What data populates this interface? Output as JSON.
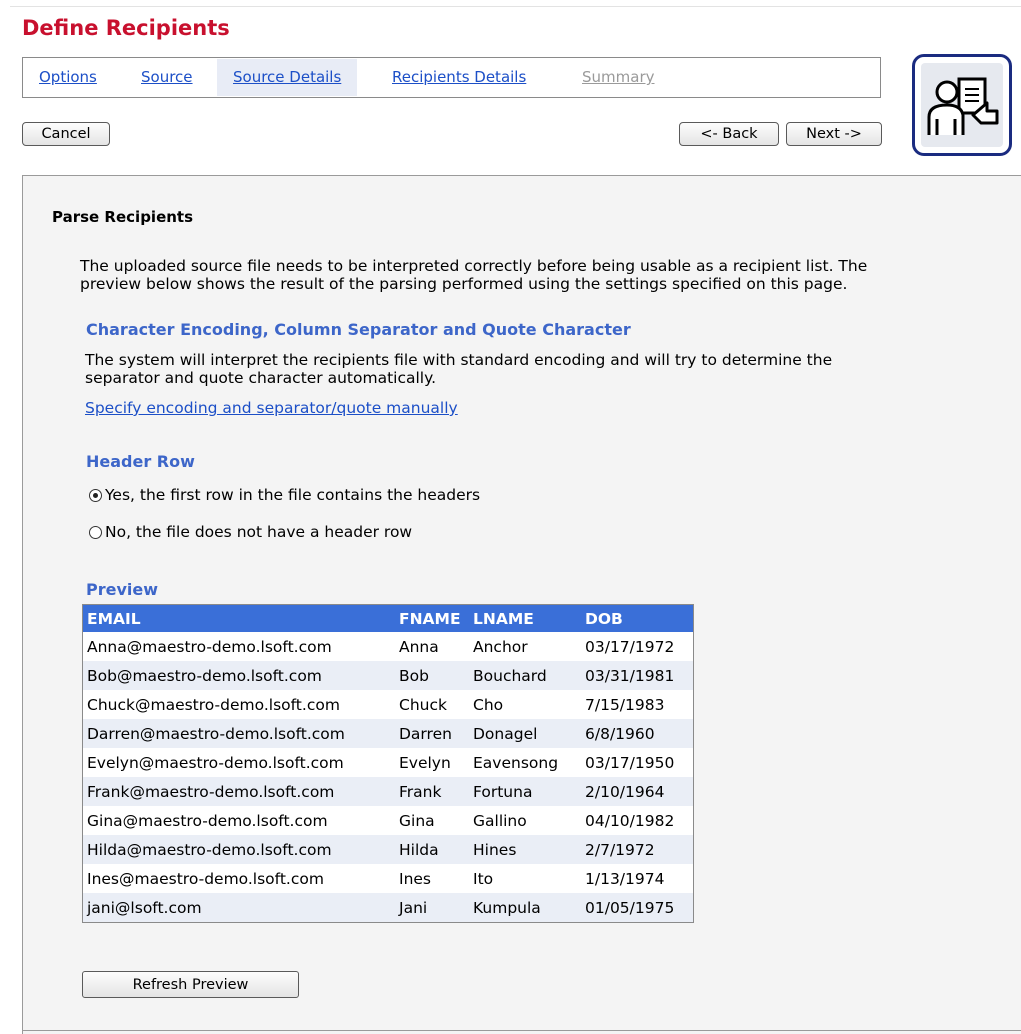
{
  "page": {
    "title": "Define Recipients"
  },
  "tabs": [
    {
      "label": "Options",
      "state": "link"
    },
    {
      "label": "Source",
      "state": "link"
    },
    {
      "label": "Source Details",
      "state": "active"
    },
    {
      "label": "Recipients Details",
      "state": "link"
    },
    {
      "label": "Summary",
      "state": "disabled"
    }
  ],
  "toolbar": {
    "cancel_label": "Cancel",
    "back_label": "<- Back",
    "next_label": "Next ->"
  },
  "logo": {
    "icon": "presenter-board-icon",
    "border_color": "#1a2b80"
  },
  "section": {
    "title": "Parse Recipients",
    "intro_line1": "The uploaded source file needs to be interpreted correctly before being usable as a recipient list. The",
    "intro_line2": "preview below shows the result of the parsing performed using the settings specified on this page.",
    "encoding": {
      "heading": "Character Encoding, Column Separator and Quote Character",
      "text_line1": "The system will interpret the recipients file with standard encoding and will try to determine the",
      "text_line2": "separator and quote character automatically.",
      "manual_link": "Specify encoding and separator/quote manually"
    },
    "header_row": {
      "heading": "Header Row",
      "options": [
        {
          "label": "Yes, the first row in the file contains the headers",
          "checked": true
        },
        {
          "label": "No, the file does not have a header row",
          "checked": false
        }
      ]
    },
    "preview": {
      "heading": "Preview",
      "columns": [
        "EMAIL",
        "FNAME",
        "LNAME",
        "DOB"
      ],
      "rows": [
        [
          "Anna@maestro-demo.lsoft.com",
          "Anna",
          "Anchor",
          "03/17/1972"
        ],
        [
          "Bob@maestro-demo.lsoft.com",
          "Bob",
          "Bouchard",
          "03/31/1981"
        ],
        [
          "Chuck@maestro-demo.lsoft.com",
          "Chuck",
          "Cho",
          "7/15/1983"
        ],
        [
          "Darren@maestro-demo.lsoft.com",
          "Darren",
          "Donagel",
          "6/8/1960"
        ],
        [
          "Evelyn@maestro-demo.lsoft.com",
          "Evelyn",
          "Eavensong",
          "03/17/1950"
        ],
        [
          "Frank@maestro-demo.lsoft.com",
          "Frank",
          "Fortuna",
          "2/10/1964"
        ],
        [
          "Gina@maestro-demo.lsoft.com",
          "Gina",
          "Gallino",
          "04/10/1982"
        ],
        [
          "Hilda@maestro-demo.lsoft.com",
          "Hilda",
          "Hines",
          "2/7/1972"
        ],
        [
          "Ines@maestro-demo.lsoft.com",
          "Ines",
          "Ito",
          "1/13/1974"
        ],
        [
          "jani@lsoft.com",
          "Jani",
          "Kumpula",
          "01/05/1975"
        ]
      ],
      "header_color": "#3a6fd8",
      "refresh_label": "Refresh Preview"
    }
  },
  "colors": {
    "title": "#c8102e",
    "link": "#1c4fc7",
    "section_heading": "#3d66c9"
  }
}
